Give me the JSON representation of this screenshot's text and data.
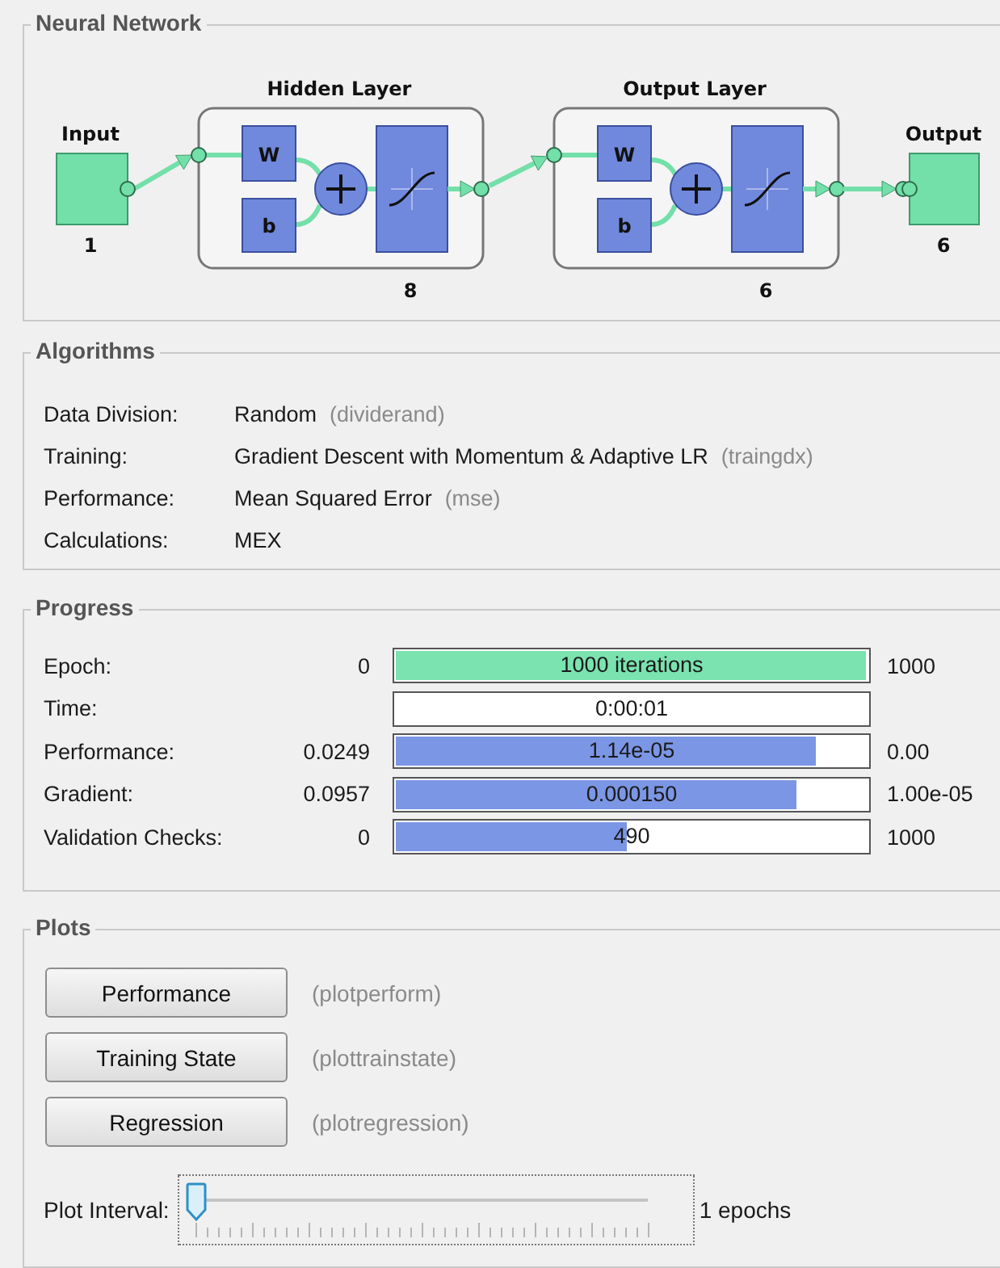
{
  "network": {
    "title": "Neural Network",
    "input": {
      "label": "Input",
      "size": "1"
    },
    "layers": [
      {
        "title": "Hidden Layer",
        "weight": "W",
        "bias": "b",
        "size": "8"
      },
      {
        "title": "Output Layer",
        "weight": "W",
        "bias": "b",
        "size": "6"
      }
    ],
    "output": {
      "label": "Output",
      "size": "6"
    }
  },
  "algorithms": {
    "title": "Algorithms",
    "rows": [
      {
        "label": "Data Division:",
        "value": "Random",
        "function": "(dividerand)"
      },
      {
        "label": "Training:",
        "value": "Gradient Descent with Momentum & Adaptive LR",
        "function": "(traingdx)"
      },
      {
        "label": "Performance:",
        "value": "Mean Squared Error",
        "function": "(mse)"
      },
      {
        "label": "Calculations:",
        "value": "MEX"
      }
    ]
  },
  "progress": {
    "title": "Progress",
    "rows": [
      {
        "label": "Epoch:",
        "start": "0",
        "reading": "1000 iterations",
        "end": "1000",
        "level": 0.995,
        "color": "#7ae3b0"
      },
      {
        "label": "Time:",
        "reading": "0:00:01"
      },
      {
        "label": "Performance:",
        "start": "0.0249",
        "reading": "1.14e-05",
        "end": "0.00",
        "level": 0.89,
        "color": "#7b96e4"
      },
      {
        "label": "Gradient:",
        "start": "0.0957",
        "reading": "0.000150",
        "end": "1.00e-05",
        "level": 0.85,
        "color": "#7b96e4"
      },
      {
        "label": "Validation Checks:",
        "start": "0",
        "reading": "490",
        "end": "1000",
        "level": 0.49,
        "color": "#7b96e4"
      }
    ]
  },
  "plots": {
    "title": "Plots",
    "buttons": [
      {
        "label": "Performance",
        "function": "(plotperform)"
      },
      {
        "label": "Training State",
        "function": "(plottrainstate)"
      },
      {
        "label": "Regression",
        "function": "(plotregression)"
      }
    ],
    "plot_interval": {
      "label": "Plot Interval:",
      "level": 0,
      "reading": "1 epochs"
    }
  }
}
